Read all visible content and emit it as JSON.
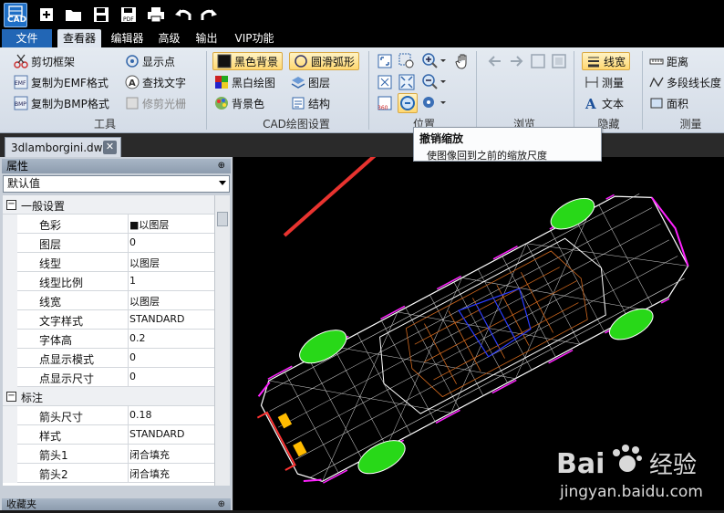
{
  "app": {
    "logo_text": "CAD"
  },
  "quick_access": [
    "new-icon",
    "open-icon",
    "save-icon",
    "save-as-icon",
    "print-icon",
    "undo-icon",
    "redo-icon"
  ],
  "menu": {
    "file": "文件",
    "tabs": [
      "查看器",
      "编辑器",
      "高级",
      "输出",
      "VIP功能"
    ],
    "active": "查看器"
  },
  "ribbon": {
    "tools": {
      "items": [
        "剪切框架",
        "复制为EMF格式",
        "复制为BMP格式",
        "显示点",
        "查找文字",
        "修剪光栅"
      ],
      "label": "工具"
    },
    "cad_settings": {
      "items": [
        "黑色背景",
        "黑白绘图",
        "背景色",
        "圆滑弧形",
        "图层",
        "结构"
      ],
      "label": "CAD绘图设置"
    },
    "position": {
      "label": "位置"
    },
    "browse": {
      "label": "浏览"
    },
    "hide": {
      "items": [
        "线宽",
        "测量",
        "文本"
      ],
      "label": "隐藏"
    },
    "measure": {
      "items": [
        "距离",
        "多段线长度",
        "面积"
      ],
      "label": "测量"
    }
  },
  "tooltip": {
    "title": "撤销缩放",
    "desc": "使图像回到之前的缩放尺度"
  },
  "document_tab": {
    "name": "3dlamborgini.dwg",
    "close": "✕"
  },
  "properties": {
    "title": "属性",
    "pin": "⊕",
    "dropdown_value": "默认值",
    "rows": [
      {
        "cat": true,
        "toggle": "−",
        "name": "一般设置"
      },
      {
        "name": "色彩",
        "value": "■以图层"
      },
      {
        "name": "图层",
        "value": "0"
      },
      {
        "name": "线型",
        "value": "以图层"
      },
      {
        "name": "线型比例",
        "value": "1"
      },
      {
        "name": "线宽",
        "value": "以图层"
      },
      {
        "name": "文字样式",
        "value": "STANDARD"
      },
      {
        "name": "字体高",
        "value": "0.2"
      },
      {
        "name": "点显示模式",
        "value": "0"
      },
      {
        "name": "点显示尺寸",
        "value": "0"
      },
      {
        "cat": true,
        "toggle": "−",
        "name": "标注"
      },
      {
        "name": "箭头尺寸",
        "value": "0.18"
      },
      {
        "name": "样式",
        "value": "STANDARD"
      },
      {
        "name": "箭头1",
        "value": "闭合填充"
      },
      {
        "name": "箭头2",
        "value": "闭合填充"
      }
    ]
  },
  "favorites": {
    "title": "收藏夹",
    "pin": "⊕"
  },
  "watermark": {
    "brand": "Bai",
    "brand2": "经验",
    "url": "jingyan.baidu.com"
  }
}
